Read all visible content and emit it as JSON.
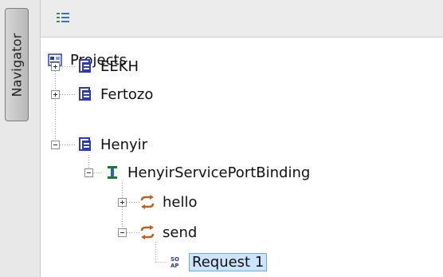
{
  "navigator": {
    "tab_label": "Navigator"
  },
  "toolbar": {
    "tree_icon": "tree-list-icon"
  },
  "tree": {
    "root": {
      "label": "Projects",
      "icon": "projects-icon"
    },
    "projects": [
      {
        "label": "EEKH",
        "icon": "project-icon",
        "expanded": false
      },
      {
        "label": "Fertozo",
        "icon": "project-icon",
        "expanded": false
      },
      {
        "label": "Henyir",
        "icon": "project-icon",
        "expanded": true
      }
    ],
    "binding": {
      "label": "HenyirServicePortBinding",
      "icon": "interface-icon",
      "expanded": true
    },
    "operations": [
      {
        "label": "hello",
        "icon": "operation-icon",
        "expanded": false
      },
      {
        "label": "send",
        "icon": "operation-icon",
        "expanded": true
      }
    ],
    "request": {
      "label": "Request 1",
      "icon": "soap-request-icon",
      "selected": true
    }
  },
  "colors": {
    "selection_bg": "#cce4ff",
    "selection_border": "#6fa8e8",
    "project_icon": "#2b3bbf",
    "operation_icon": "#c0601c",
    "interface_icon": "#1e7a2e"
  }
}
